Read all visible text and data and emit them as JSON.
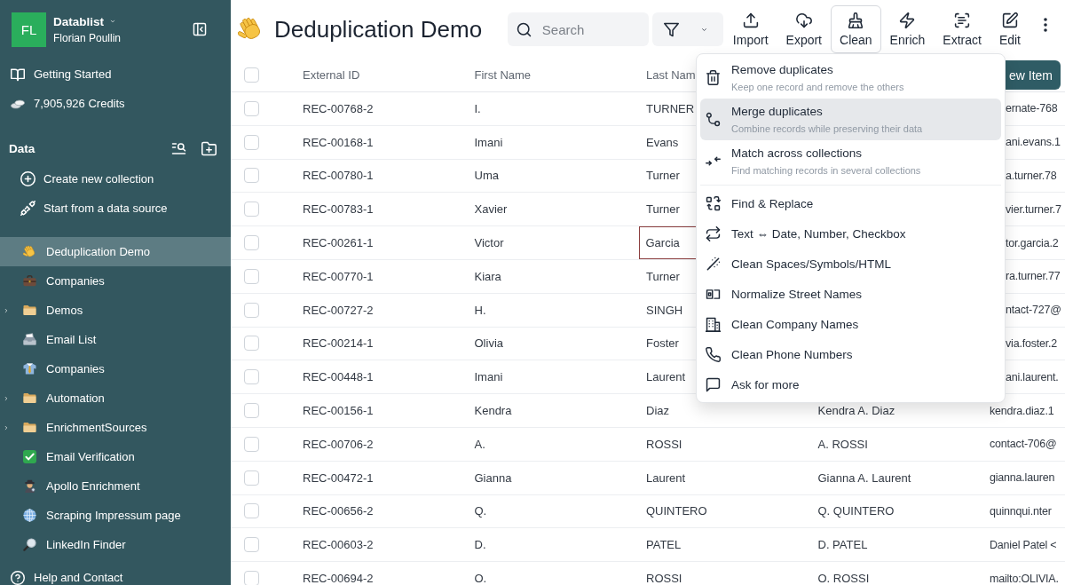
{
  "sidebar": {
    "workspace": {
      "initials": "FL",
      "name": "Datablist",
      "user": "Florian Poullin"
    },
    "links": [
      {
        "label": "Getting Started"
      },
      {
        "label": "7,905,926 Credits"
      }
    ],
    "section_title": "Data",
    "actions": [
      {
        "label": "Create new collection"
      },
      {
        "label": "Start from a data source"
      }
    ],
    "collections": [
      {
        "label": "Deduplication Demo",
        "kind": "collection",
        "selected": true
      },
      {
        "label": "Companies",
        "kind": "collection",
        "selected": false
      },
      {
        "label": "Demos",
        "kind": "folder",
        "selected": false,
        "expanded": false
      },
      {
        "label": "Email List",
        "kind": "collection",
        "selected": false
      },
      {
        "label": "Companies",
        "kind": "collection",
        "selected": false
      },
      {
        "label": "Automation",
        "kind": "folder",
        "selected": false,
        "expanded": false
      },
      {
        "label": "EnrichmentSources",
        "kind": "folder",
        "selected": false,
        "expanded": false
      },
      {
        "label": "Email Verification",
        "kind": "collection",
        "selected": false
      },
      {
        "label": "Apollo Enrichment",
        "kind": "collection",
        "selected": false
      },
      {
        "label": "Scraping Impressum page",
        "kind": "collection",
        "selected": false
      },
      {
        "label": "LinkedIn Finder",
        "kind": "collection",
        "selected": false
      }
    ],
    "help": "Help and Contact"
  },
  "header": {
    "title": "Deduplication Demo",
    "search": {
      "placeholder": "Search"
    },
    "toolbar": [
      {
        "label": "Import",
        "selected": false
      },
      {
        "label": "Export",
        "selected": false
      },
      {
        "label": "Clean",
        "selected": true
      },
      {
        "label": "Enrich",
        "selected": false
      },
      {
        "label": "Extract",
        "selected": false
      },
      {
        "label": "Edit",
        "selected": false
      }
    ]
  },
  "table": {
    "select_all_checked": false,
    "columns": [
      {
        "label": "External ID"
      },
      {
        "label": "First Name"
      },
      {
        "label": "Last Nam"
      }
    ],
    "new_item_button": "ew Item",
    "rows": [
      {
        "checked": false,
        "external_id": "REC-00768-2",
        "first_name": "I.",
        "last_name": "TURNER",
        "last_name_focused": false,
        "column_5": "ernate-768"
      },
      {
        "checked": false,
        "external_id": "REC-00168-1",
        "first_name": "Imani",
        "last_name": "Evans",
        "last_name_focused": false,
        "column_5": "ani.evans.1"
      },
      {
        "checked": false,
        "external_id": "REC-00780-1",
        "first_name": "Uma",
        "last_name": "Turner",
        "last_name_focused": false,
        "column_5": "a.turner.78"
      },
      {
        "checked": false,
        "external_id": "REC-00783-1",
        "first_name": "Xavier",
        "last_name": "Turner",
        "last_name_focused": false,
        "column_5": "vier.turner.7"
      },
      {
        "checked": false,
        "external_id": "REC-00261-1",
        "first_name": "Victor",
        "last_name": "Garcia",
        "last_name_focused": true,
        "column_5": "tor.garcia.2"
      },
      {
        "checked": false,
        "external_id": "REC-00770-1",
        "first_name": "Kiara",
        "last_name": "Turner",
        "last_name_focused": false,
        "column_5": "ra.turner.77"
      },
      {
        "checked": false,
        "external_id": "REC-00727-2",
        "first_name": "H.",
        "last_name": "SINGH",
        "last_name_focused": false,
        "column_5": "ntact-727@"
      },
      {
        "checked": false,
        "external_id": "REC-00214-1",
        "first_name": "Olivia",
        "last_name": "Foster",
        "last_name_focused": false,
        "column_5": "via.foster.2"
      },
      {
        "checked": false,
        "external_id": "REC-00448-1",
        "first_name": "Imani",
        "last_name": "Laurent",
        "last_name_focused": false,
        "column_5": "ani.laurent."
      },
      {
        "checked": false,
        "external_id": "REC-00156-1",
        "first_name": "Kendra",
        "last_name": "Diaz",
        "last_name_focused": false,
        "column_4": "Kendra A. Diaz",
        "column_5": "kendra.diaz.1"
      },
      {
        "checked": false,
        "external_id": "REC-00706-2",
        "first_name": "A.",
        "last_name": "ROSSI",
        "last_name_focused": false,
        "column_4": "A. ROSSI",
        "column_5": "contact-706@"
      },
      {
        "checked": false,
        "external_id": "REC-00472-1",
        "first_name": "Gianna",
        "last_name": "Laurent",
        "last_name_focused": false,
        "column_4": "Gianna A. Laurent",
        "column_5": "gianna.lauren"
      },
      {
        "checked": false,
        "external_id": "REC-00656-2",
        "first_name": "Q.",
        "last_name": "QUINTERO",
        "last_name_focused": false,
        "column_4": "Q. QUINTERO",
        "column_5": "quinnqui.nter"
      },
      {
        "checked": false,
        "external_id": "REC-00603-2",
        "first_name": "D.",
        "last_name": "PATEL",
        "last_name_focused": false,
        "column_4": "D. PATEL",
        "column_5": "Daniel Patel <"
      },
      {
        "checked": false,
        "external_id": "REC-00694-2",
        "first_name": "O.",
        "last_name": "ROSSI",
        "last_name_focused": false,
        "column_4": "O. ROSSI",
        "column_5": "mailto:OLIVIA."
      }
    ]
  },
  "clean_menu": {
    "sections": [
      {
        "items": [
          {
            "title": "Remove duplicates",
            "description": "Keep one record and remove the others",
            "selected": false
          },
          {
            "title": "Merge duplicates",
            "description": "Combine records while preserving their data",
            "selected": true
          },
          {
            "title": "Match across collections",
            "description": "Find matching records in several collections",
            "selected": false
          }
        ]
      },
      {
        "items": [
          {
            "title": "Find & Replace",
            "selected": false
          },
          {
            "title": "Text ⇔ Date, Number, Checkbox",
            "selected": false
          },
          {
            "title": "Clean Spaces/Symbols/HTML",
            "selected": false
          },
          {
            "title": "Normalize Street Names",
            "selected": false
          },
          {
            "title": "Clean Company Names",
            "selected": false
          },
          {
            "title": "Clean Phone Numbers",
            "selected": false
          },
          {
            "title": "Ask for more",
            "selected": false
          }
        ]
      }
    ]
  }
}
